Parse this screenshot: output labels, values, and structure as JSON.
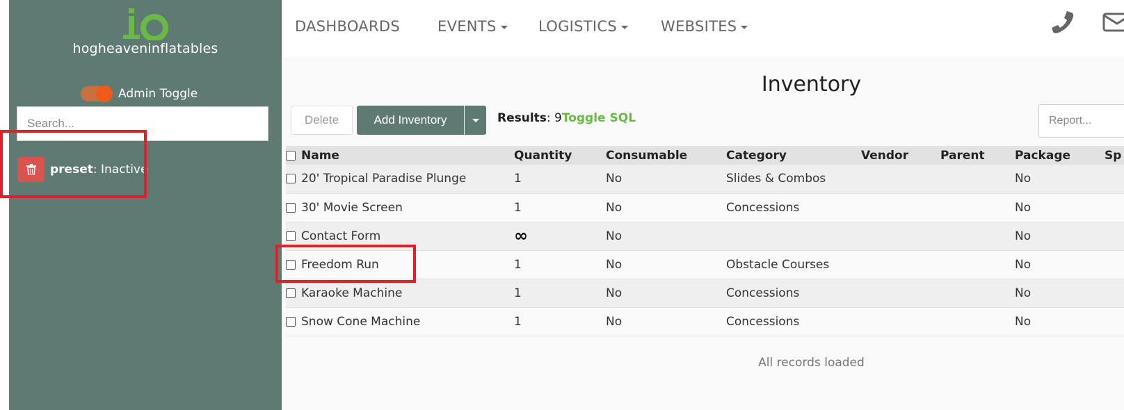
{
  "sidebar": {
    "brand": "hogheaveninflatables",
    "admin_toggle_label": "Admin Toggle",
    "search_placeholder": "Search...",
    "preset": {
      "name": "preset",
      "status": ": Inactive"
    }
  },
  "nav": {
    "items": [
      {
        "label": "DASHBOARDS"
      },
      {
        "label": "EVENTS"
      },
      {
        "label": "LOGISTICS"
      },
      {
        "label": "WEBSITES"
      }
    ]
  },
  "main": {
    "title": "Inventory",
    "delete_label": "Delete",
    "add_label": "Add Inventory",
    "results_label": "Results",
    "results_count": ": 9",
    "toggle_sql": "Toggle SQL",
    "report_placeholder": "Report...",
    "footer": "All records loaded"
  },
  "table": {
    "columns": [
      "Name",
      "Quantity",
      "Consumable",
      "Category",
      "Vendor",
      "Parent",
      "Package",
      "Sp"
    ],
    "rows": [
      {
        "name": "20' Tropical Paradise Plunge",
        "quantity": "1",
        "consumable": "No",
        "category": "Slides & Combos",
        "vendor": "",
        "parent": "",
        "package": "No"
      },
      {
        "name": "30' Movie Screen",
        "quantity": "1",
        "consumable": "No",
        "category": "Concessions",
        "vendor": "",
        "parent": "",
        "package": "No"
      },
      {
        "name": "Contact Form",
        "quantity": "∞",
        "consumable": "No",
        "category": "",
        "vendor": "",
        "parent": "",
        "package": "No"
      },
      {
        "name": "Freedom Run",
        "quantity": "1",
        "consumable": "No",
        "category": "Obstacle Courses",
        "vendor": "",
        "parent": "",
        "package": "No"
      },
      {
        "name": "Karaoke Machine",
        "quantity": "1",
        "consumable": "No",
        "category": "Concessions",
        "vendor": "",
        "parent": "",
        "package": "No"
      },
      {
        "name": "Snow Cone Machine",
        "quantity": "1",
        "consumable": "No",
        "category": "Concessions",
        "vendor": "",
        "parent": "",
        "package": "No"
      }
    ]
  },
  "colors": {
    "sidebar_bg": "#5f7a72",
    "accent_green": "#6ab946",
    "toggle_orange": "#f05a1c",
    "delete_red": "#d9534f",
    "annotation_red": "#e0212b"
  },
  "icons": [
    "io-logo",
    "trash-icon",
    "phone-icon",
    "mail-icon",
    "caret-down-icon",
    "infinity-icon",
    "checkbox"
  ]
}
